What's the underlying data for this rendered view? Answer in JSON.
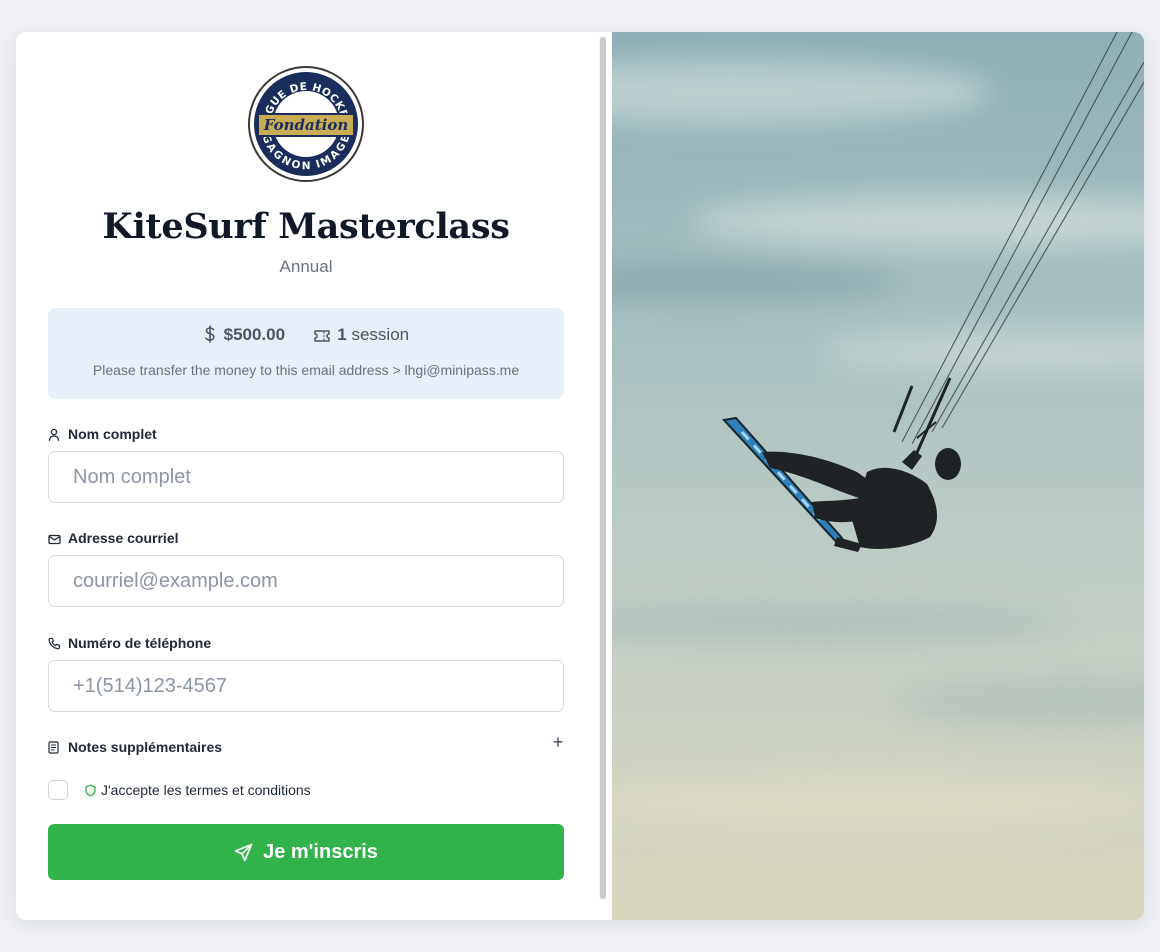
{
  "form": {
    "logo_text": {
      "top": "LIGUE DE HOCKEY",
      "banner": "Fondation",
      "bottom": "GAGNON IMAGE"
    },
    "title": "KiteSurf Masterclass",
    "subtitle": "Annual",
    "price": {
      "currency_icon": "dollar-icon",
      "amount": "$500.00",
      "session_icon": "ticket-icon",
      "session_count": "1",
      "session_label": "session"
    },
    "transfer_note": "Please transfer the money to this email address > lhgi@minipass.me",
    "fields": {
      "name": {
        "icon": "user-icon",
        "label": "Nom complet",
        "placeholder": "Nom complet",
        "value": ""
      },
      "email": {
        "icon": "mail-icon",
        "label": "Adresse courriel",
        "placeholder": "courriel@example.com",
        "value": ""
      },
      "phone": {
        "icon": "phone-icon",
        "label": "Numéro de téléphone",
        "placeholder": "+1(514)123-4567",
        "value": ""
      }
    },
    "notes": {
      "icon": "document-icon",
      "label": "Notes supplémentaires",
      "toggle": "+"
    },
    "terms": {
      "checked": false,
      "icon": "shield-icon",
      "label": "J'accepte les termes et conditions"
    },
    "submit": {
      "icon": "send-icon",
      "label": "Je m'inscris"
    }
  },
  "colors": {
    "accent": "#31b34a",
    "info_bg": "#e7f0f9",
    "title": "#111827",
    "logo_navy": "#1b2d5c",
    "logo_gold": "#c9ad55"
  }
}
